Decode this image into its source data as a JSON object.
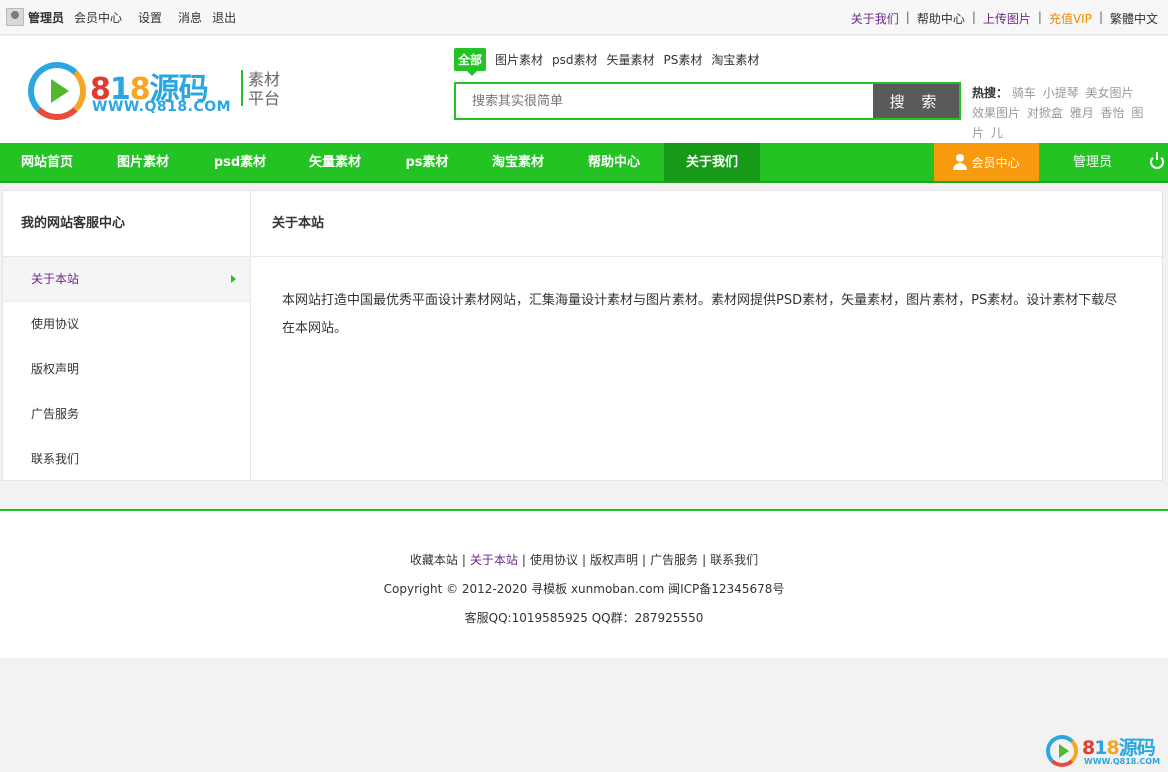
{
  "topbar": {
    "username": "管理员",
    "left_links": [
      "会员中心",
      "设置",
      "消息",
      "退出"
    ],
    "right_links": [
      "关于我们",
      "帮助中心",
      "上传图片",
      "充值VIP",
      "繁體中文"
    ],
    "separator": "|"
  },
  "logo": {
    "digit1": "8",
    "digit2": "1",
    "digit3": "8",
    "chars": "源码",
    "url": "WWW.Q818.COM",
    "slogan_line1": "素材",
    "slogan_line2": "平台"
  },
  "search": {
    "tabs": [
      "全部",
      "图片素材",
      "psd素材",
      "矢量素材",
      "PS素材",
      "淘宝素材"
    ],
    "active_tab": "全部",
    "placeholder": "搜索其实很简单",
    "button_label": "搜 索",
    "hot_label": "热搜：",
    "hot_keywords": [
      "骑车",
      "小提琴",
      "美女图片",
      "效果图片",
      "对掀盒",
      "雅月",
      "香怡",
      "图片",
      "儿"
    ]
  },
  "nav": {
    "items": [
      "网站首页",
      "图片素材",
      "psd素材",
      "矢量素材",
      "ps素材",
      "淘宝素材",
      "帮助中心",
      "关于我们"
    ],
    "active_item": "关于我们",
    "member_label": "会员中心",
    "admin_label": "管理员"
  },
  "sidebar": {
    "title": "我的网站客服中心",
    "items": [
      "关于本站",
      "使用协议",
      "版权声明",
      "广告服务",
      "联系我们"
    ],
    "active_item": "关于本站"
  },
  "content": {
    "title": "关于本站",
    "body": "本网站打造中国最优秀平面设计素材网站，汇集海量设计素材与图片素材。素材网提供PSD素材，矢量素材，图片素材，PS素材。设计素材下载尽在本网站。"
  },
  "footer": {
    "links": [
      "收藏本站",
      "关于本站",
      "使用协议",
      "版权声明",
      "广告服务",
      "联系我们"
    ],
    "active_link": "关于本站",
    "copyright": "Copyright © 2012-2020 寻模板 xunmoban.com 闽ICP备12345678号",
    "qq": "客服QQ:1019585925 QQ群：287925550"
  },
  "colors": {
    "brand_green": "#22c322",
    "nav_active_green": "#179a17",
    "member_orange": "#f79a0e",
    "link_purple": "#6a2b8a",
    "vip_orange": "#f08a00"
  },
  "icons": [
    "avatar-icon",
    "play-logo-icon",
    "user-icon",
    "power-icon",
    "chevron-right-icon"
  ]
}
